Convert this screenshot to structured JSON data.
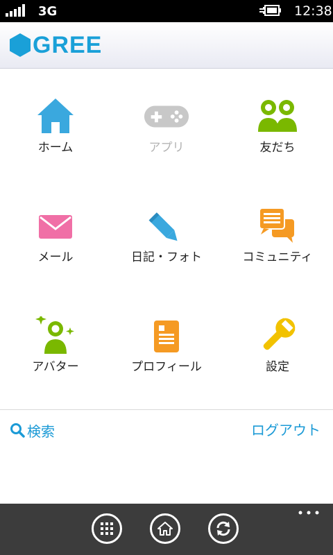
{
  "status_bar": {
    "network": "3G",
    "time": "12:38"
  },
  "header": {
    "logo_text": "GREE",
    "brand_color": "#1aa0d8"
  },
  "menu": [
    {
      "id": "home",
      "label": "ホーム",
      "icon": "house-icon",
      "enabled": true,
      "color": "#3aa8de"
    },
    {
      "id": "apps",
      "label": "アプリ",
      "icon": "gamepad-icon",
      "enabled": false,
      "color": "#c8c8c8"
    },
    {
      "id": "friends",
      "label": "友だち",
      "icon": "friends-icon",
      "enabled": true,
      "color": "#7ab800"
    },
    {
      "id": "mail",
      "label": "メール",
      "icon": "envelope-icon",
      "enabled": true,
      "color": "#f06fa6"
    },
    {
      "id": "diary",
      "label": "日記・フォト",
      "icon": "pencil-icon",
      "enabled": true,
      "color": "#3aa8de"
    },
    {
      "id": "community",
      "label": "コミュニティ",
      "icon": "chat-bubbles-icon",
      "enabled": true,
      "color": "#f59a23"
    },
    {
      "id": "avatar",
      "label": "アバター",
      "icon": "avatar-sparkle-icon",
      "enabled": true,
      "color": "#7ab800"
    },
    {
      "id": "profile",
      "label": "プロフィール",
      "icon": "profile-card-icon",
      "enabled": true,
      "color": "#f59a23"
    },
    {
      "id": "settings",
      "label": "設定",
      "icon": "wrench-icon",
      "enabled": true,
      "color": "#f2c200"
    }
  ],
  "links": {
    "search": "検索",
    "logout": "ログアウト"
  },
  "app_bar": {
    "buttons": [
      "grid-icon",
      "home-icon",
      "refresh-icon"
    ],
    "more": "..."
  }
}
